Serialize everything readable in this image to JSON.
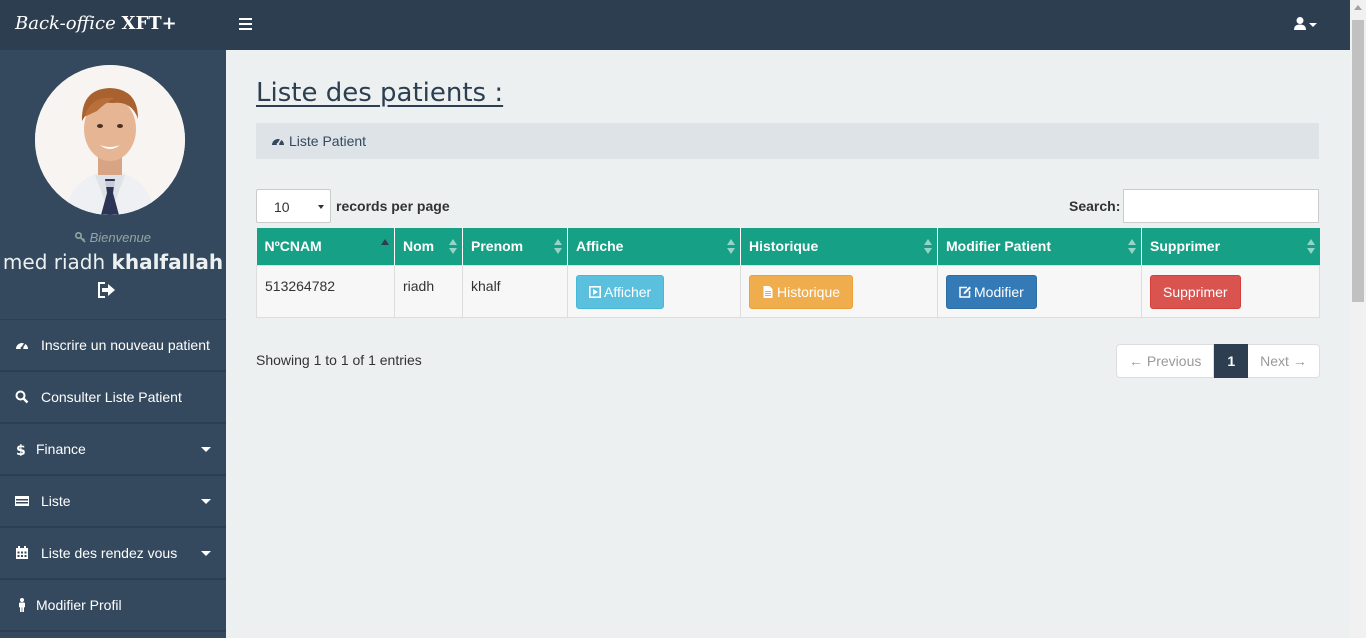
{
  "app": {
    "brand_italic": "Back-office",
    "brand_bold": "XFT+"
  },
  "sidebar": {
    "welcome": "Bienvenue",
    "user_first": "med riadh",
    "user_last": "khalfallah",
    "items": [
      {
        "label": "Inscrire un nouveau patient",
        "icon": "dashboard-icon",
        "has_caret": false
      },
      {
        "label": "Consulter Liste Patient",
        "icon": "search-icon",
        "has_caret": false
      },
      {
        "label": "Finance",
        "icon": "dollar-icon",
        "has_caret": true
      },
      {
        "label": "Liste",
        "icon": "list-icon",
        "has_caret": true
      },
      {
        "label": "Liste des rendez vous",
        "icon": "calendar-icon",
        "has_caret": true
      },
      {
        "label": "Modifier Profil",
        "icon": "male-icon",
        "has_caret": false
      }
    ]
  },
  "main": {
    "title": "Liste des patients :",
    "breadcrumb": "Liste Patient",
    "length_value": "10",
    "length_label": "records per page",
    "search_label": "Search:",
    "search_value": "",
    "columns": [
      "NºCNAM",
      "Nom",
      "Prenom",
      "Affiche",
      "Historique",
      "Modifier Patient",
      "Supprimer"
    ],
    "rows": [
      {
        "cnam": "513264782",
        "nom": "riadh",
        "prenom": "khalf",
        "afficher": "Afficher",
        "historique": "Historique",
        "modifier": "Modifier",
        "supprimer": "Supprimer"
      }
    ],
    "info": "Showing 1 to 1 of 1 entries",
    "pager": {
      "prev": "← Previous",
      "current": "1",
      "next": "Next →"
    }
  },
  "colors": {
    "navbar": "#2c3e50",
    "sidebar": "#34495e",
    "table_header": "#16a085",
    "btn_info": "#5bc0de",
    "btn_warning": "#f0ad4e",
    "btn_primary": "#337ab7",
    "btn_danger": "#d9534f"
  }
}
